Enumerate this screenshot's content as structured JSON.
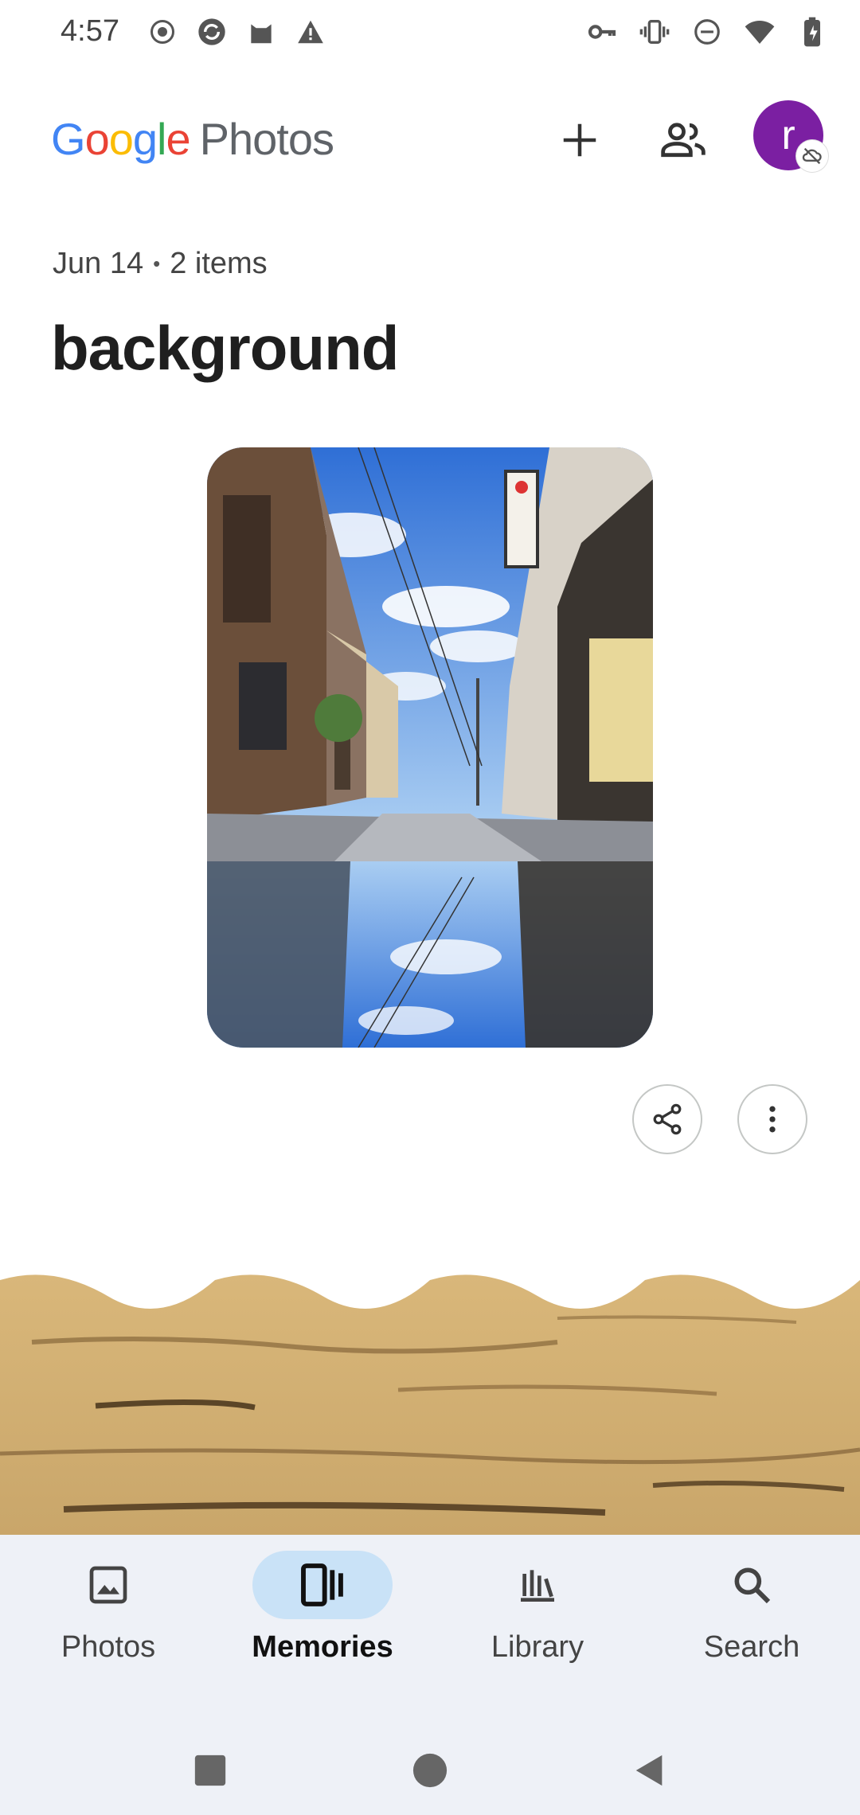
{
  "status_bar": {
    "time": "4:57",
    "left_icons": [
      "record-icon",
      "sync-icon",
      "cat-icon",
      "warning-icon"
    ],
    "right_icons": [
      "key-icon",
      "vibrate-icon",
      "dnd-icon",
      "wifi-icon",
      "battery-icon"
    ]
  },
  "app_bar": {
    "logo_letters": [
      "G",
      "o",
      "o",
      "g",
      "l",
      "e"
    ],
    "logo_product": "Photos",
    "avatar_initial": "r"
  },
  "memory": {
    "date": "Jun 14",
    "items": "2 items",
    "title": "background"
  },
  "bottom_nav": {
    "items": [
      {
        "label": "Photos",
        "icon": "image-icon"
      },
      {
        "label": "Memories",
        "icon": "memories-icon",
        "active": true
      },
      {
        "label": "Library",
        "icon": "library-icon"
      },
      {
        "label": "Search",
        "icon": "search-icon"
      }
    ]
  },
  "colors": {
    "avatar": "#7b1fa2",
    "nav_background": "#eef1f7",
    "nav_active_pill": "#c9e2f7"
  }
}
